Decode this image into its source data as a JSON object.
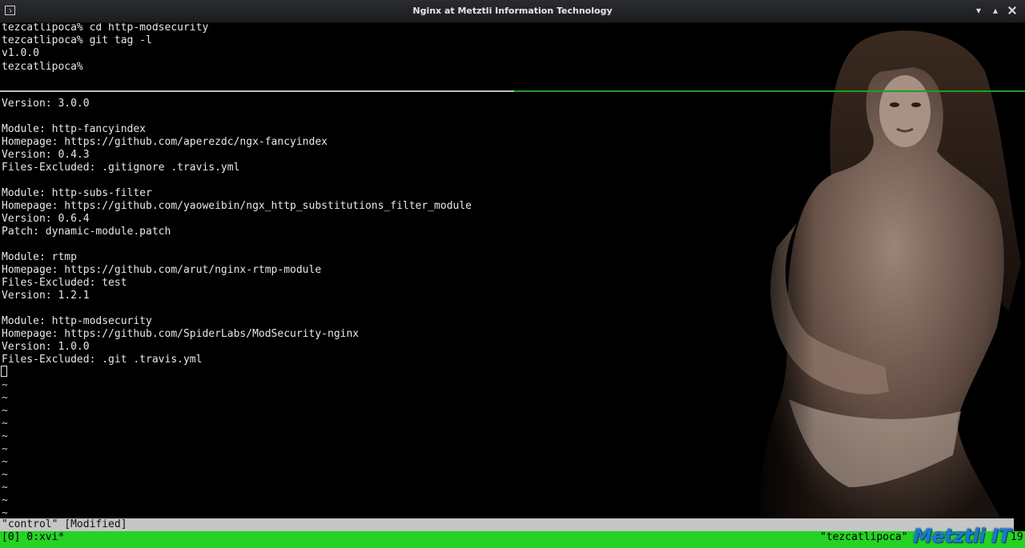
{
  "window": {
    "title": "Nginx at Metztli Information Technology"
  },
  "terminal": {
    "shell_lines": [
      "tezcatlipoca% cd http-modsecurity",
      "tezcatlipoca% git tag -l",
      "v1.0.0",
      "tezcatlipoca%"
    ],
    "editor_lines": [
      "Version: 3.0.0",
      "",
      "Module: http-fancyindex",
      "Homepage: https://github.com/aperezdc/ngx-fancyindex",
      "Version: 0.4.3",
      "Files-Excluded: .gitignore .travis.yml",
      "",
      "Module: http-subs-filter",
      "Homepage: https://github.com/yaoweibin/ngx_http_substitutions_filter_module",
      "Version: 0.6.4",
      "Patch: dynamic-module.patch",
      "",
      "Module: rtmp",
      "Homepage: https://github.com/arut/nginx-rtmp-module",
      "Files-Excluded: test",
      "Version: 1.2.1",
      "",
      "Module: http-modsecurity",
      "Homepage: https://github.com/SpiderLabs/ModSecurity-nginx",
      "Version: 1.0.0",
      "Files-Excluded: .git .travis.yml"
    ],
    "tilde": "~"
  },
  "vi_status": "\"control\" [Modified]",
  "tmux": {
    "left": "[0] 0:xvi*",
    "right": "\"tezcatlipoca\"",
    "tail": "19"
  },
  "logo_text": "Metztli IT",
  "colors": {
    "tmux_bar": "#24d324",
    "divider_active": "#1f9e1f",
    "logo": "#1e78c8"
  }
}
